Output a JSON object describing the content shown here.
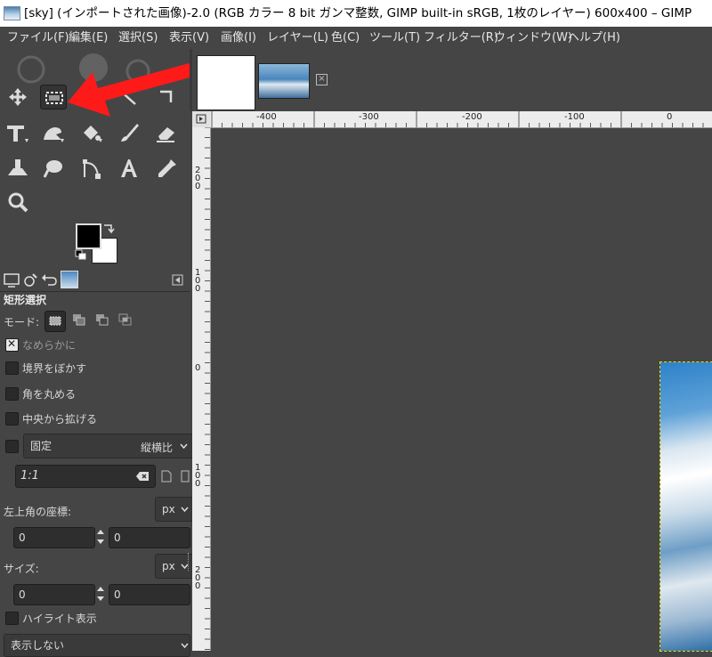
{
  "window": {
    "title": "[sky] (インポートされた画像)-2.0 (RGB カラー 8 bit ガンマ整数, GIMP built-in sRGB, 1枚のレイヤー) 600x400 – GIMP"
  },
  "menu": [
    "ファイル(F)",
    "編集(E)",
    "選択(S)",
    "表示(V)",
    "画像(I)",
    "レイヤー(L)",
    "色(C)",
    "ツール(T)",
    "フィルター(R)",
    "ウィンドウ(W)",
    "ヘルプ(H)"
  ],
  "toolbox": {
    "tools": [
      "move-tool-icon",
      "rect-select-tool-icon",
      "free-select-tool-icon",
      "crop-tool-icon",
      "warp-tool-icon",
      "smudge-tool-icon",
      "bucket-fill-tool-icon",
      "paintbrush-tool-icon",
      "eraser-tool-icon",
      "clone-tool-icon",
      "lasso-tool-icon",
      "paths-tool-icon",
      "text-tool-icon",
      "color-picker-tool-icon",
      "zoom-tool-icon"
    ],
    "foreground_color": "#000000",
    "background_color": "#ffffff"
  },
  "annotation": {
    "arrow_color": "#ff1a1a"
  },
  "tool_options": {
    "title": "矩形選択",
    "mode_label": "モード:",
    "antialias_label": "なめらかに",
    "antialias_checked": true,
    "feather_label": "境界をぼかす",
    "rounded_label": "角を丸める",
    "expand_label": "中央から拡げる",
    "fixed_label": "固定",
    "fixed_option": "縦横比",
    "ratio_value": "1:1",
    "position_label": "左上角の座標:",
    "position_unit": "px",
    "position_x": "0",
    "position_y": "0",
    "size_label": "サイズ:",
    "size_unit": "px",
    "size_w": "0",
    "size_h": "0",
    "highlight_label": "ハイライト表示",
    "guides_option": "表示しない"
  },
  "rulers": {
    "horizontal": [
      "-400",
      "-300",
      "-200",
      "-100",
      "0"
    ],
    "vertical": [
      "200",
      "100",
      "0",
      "100",
      "200"
    ]
  }
}
